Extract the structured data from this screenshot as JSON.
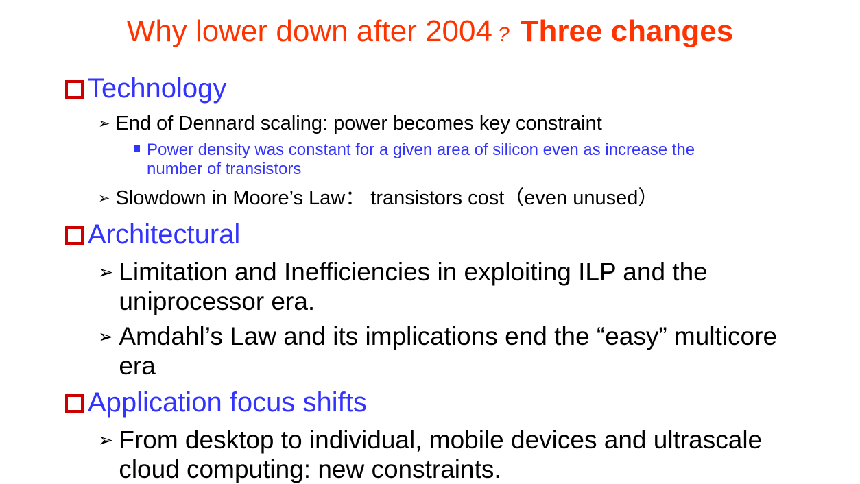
{
  "title": {
    "part1": "Why lower down after 2004",
    "qmark": "?",
    "part2": "Three changes"
  },
  "sections": [
    {
      "heading": "Technology",
      "bullets": [
        {
          "text": "End of Dennard  scaling: power becomes key constraint",
          "sub": {
            "line1": "Power density was constant for a given area of silicon even as increase the",
            "line2": "number of transistors"
          }
        },
        {
          "text": "Slowdown in Moore’s Law：  transistors cost（even unused）"
        }
      ]
    },
    {
      "heading": "Architectural",
      "bullets": [
        {
          "line1": "Limitation and Inefficiencies in exploiting ILP and the",
          "line2": "uniprocessor era."
        },
        {
          "line1": "Amdahl’s Law and its implications end the “easy” multicore",
          "line2": "era"
        }
      ]
    },
    {
      "heading": "Application focus shifts",
      "bullets": [
        {
          "line1": "From desktop to individual, mobile devices and ultrascale",
          "line2": "cloud computing:  new constraints."
        }
      ]
    }
  ],
  "icons": {
    "section_bullet": "hollow-square-icon",
    "level2_bullet": "arrowhead-icon",
    "level3_bullet": "filled-square-icon"
  },
  "colors": {
    "title": "#ff3300",
    "heading": "#3333ff",
    "section_box": "#cc0000",
    "body": "#000000",
    "subbullet": "#3333ff"
  }
}
